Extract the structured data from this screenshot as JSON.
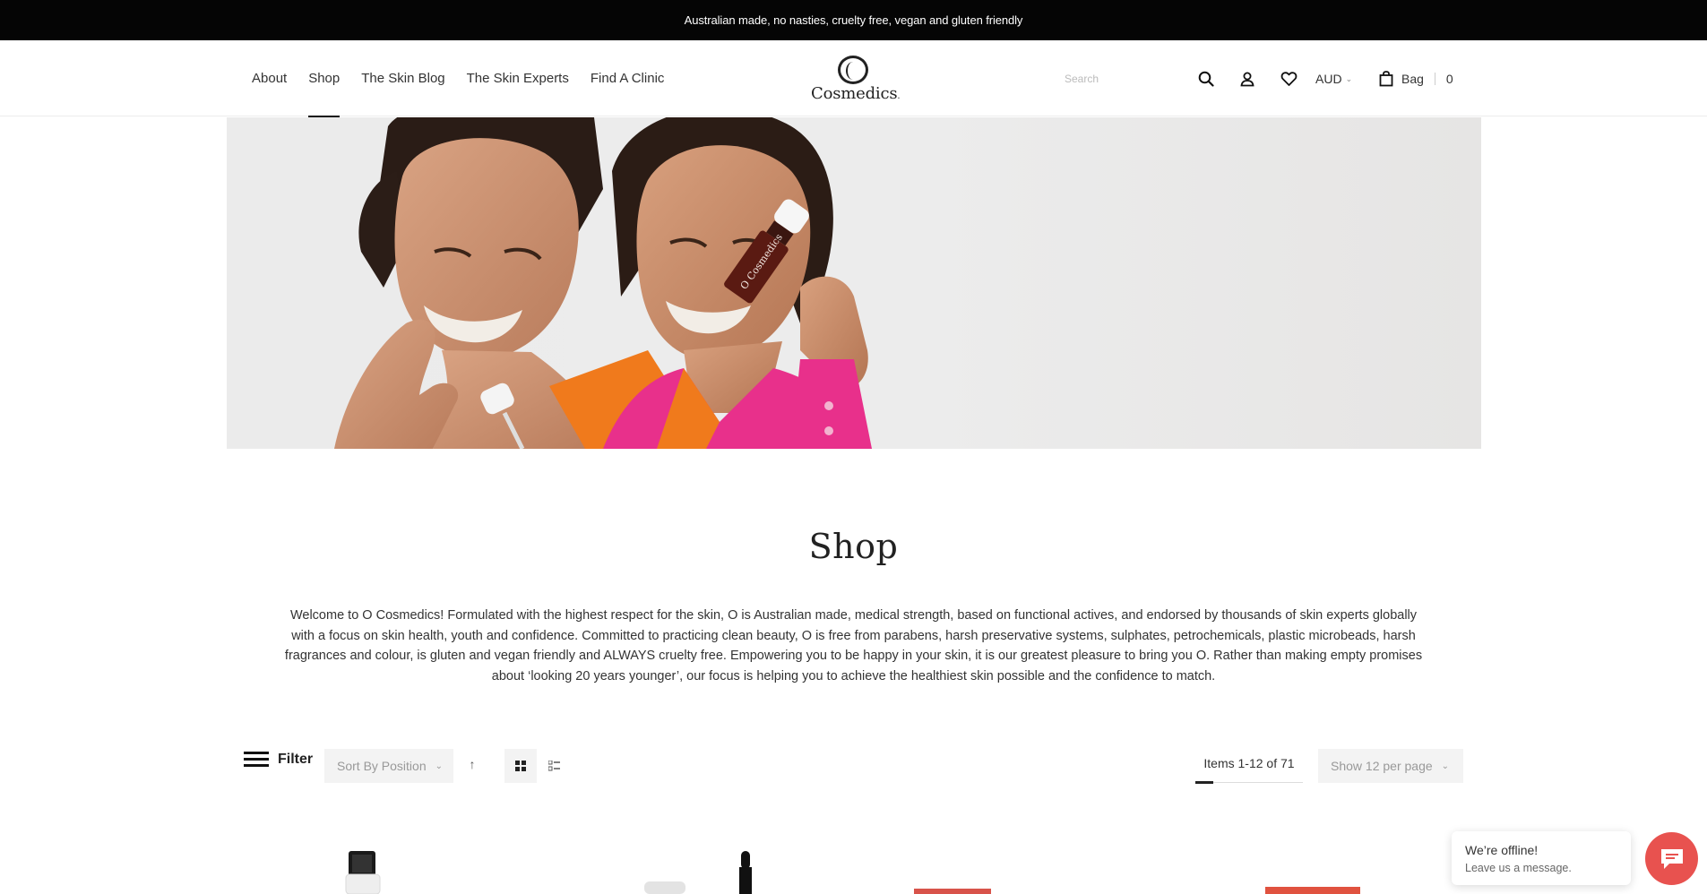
{
  "announcement": "Australian made, no nasties, cruelty free, vegan and gluten friendly",
  "nav": {
    "items": [
      {
        "label": "About"
      },
      {
        "label": "Shop"
      },
      {
        "label": "The Skin Blog"
      },
      {
        "label": "The Skin Experts"
      },
      {
        "label": "Find A Clinic"
      }
    ],
    "active": "Shop"
  },
  "logo": {
    "mark": "O",
    "word": "Cosmedics",
    "trademark": "."
  },
  "header": {
    "search_placeholder": "Search",
    "currency": "AUD",
    "bag_label": "Bag",
    "bag_count": "0",
    "icons": [
      "search-icon",
      "account-icon",
      "wishlist-heart-icon",
      "chevron-down-icon",
      "shopping-bag-icon"
    ]
  },
  "hero": {
    "bottle_label": "O Cosmedics"
  },
  "page": {
    "title": "Shop",
    "description": "Welcome to O Cosmedics! Formulated with the highest respect for the skin, O is Australian made, medical strength, based on functional actives, and endorsed by thousands of skin experts globally with a focus on skin health, youth and confidence. Committed to practicing clean beauty, O is free from parabens, harsh preservative systems, sulphates, petrochemicals, plastic microbeads, harsh fragrances and colour, is gluten and vegan friendly and ALWAYS cruelty free. Empowering you to be happy in your skin, it is our greatest pleasure to bring you O. Rather than making empty promises about ‘looking 20 years younger’, our focus is helping you to achieve the healthiest skin possible and the confidence to match."
  },
  "toolbar": {
    "filter_label": "Filter",
    "sort_label": "Sort By Position",
    "items_label": "Items 1-12 of 71",
    "per_page_label": "Show 12 per page"
  },
  "chat": {
    "status": "We’re offline!",
    "prompt": "Leave us a message."
  },
  "colors": {
    "announcement_bg": "#050505",
    "chat_accent": "#e8524f",
    "pink_shirt": "#e8308b",
    "orange_shirt": "#f07a1c"
  }
}
